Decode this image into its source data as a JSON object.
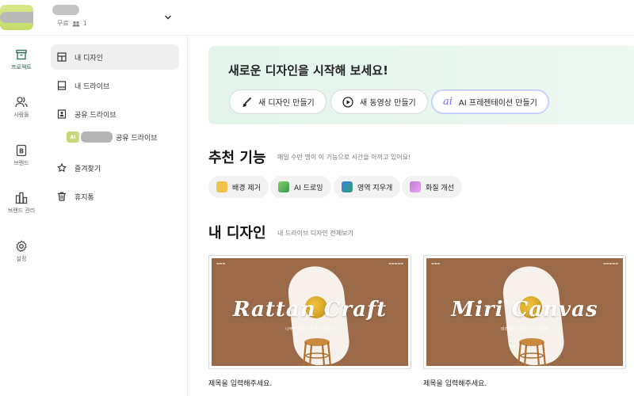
{
  "header": {
    "plan": "무료",
    "members": "1"
  },
  "rail": {
    "items": [
      {
        "label": "프로젝트",
        "icon": "project-icon"
      },
      {
        "label": "사람들",
        "icon": "people-icon"
      },
      {
        "label": "브랜드",
        "icon": "brand-icon"
      },
      {
        "label": "브랜드 관리",
        "icon": "brand-manage-icon"
      },
      {
        "label": "설정",
        "icon": "gear-icon"
      }
    ]
  },
  "sidebar": {
    "items": [
      {
        "label": "내 디자인",
        "icon": "grid-icon",
        "active": true
      },
      {
        "label": "내 드라이브",
        "icon": "drive-icon"
      },
      {
        "label": "공유 드라이브",
        "icon": "shared-drive-icon"
      },
      {
        "label": "즐겨찾기",
        "icon": "star-icon"
      },
      {
        "label": "휴지통",
        "icon": "trash-icon"
      }
    ],
    "shared_sub": {
      "badge": "AI",
      "label": "공유 드라이브"
    }
  },
  "hero": {
    "title": "새로운 디자인을 시작해 보세요!",
    "buttons": [
      {
        "label": "새 디자인 만들기",
        "icon": "brush-icon"
      },
      {
        "label": "새 동영상 만들기",
        "icon": "play-circle-icon"
      },
      {
        "label": "AI 프레젠테이션 만들기",
        "icon": "ai-icon",
        "mark": "ai"
      }
    ]
  },
  "features": {
    "title": "추천 기능",
    "subtitle": "매일 수만 명이 이 기능으로 시간을 아끼고 있어요!",
    "chips": [
      {
        "label": "배경 제거",
        "color": "#f3c24a"
      },
      {
        "label": "AI 드로잉",
        "color": "#7fcf6a"
      },
      {
        "label": "영역 지우개",
        "color": "#3f7fe0"
      },
      {
        "label": "화질 개선",
        "color": "#c27ad8"
      }
    ]
  },
  "designs": {
    "title": "내 디자인",
    "subtitle": "내 드라이브 디자인 전체보기",
    "cards": [
      {
        "thumb_title": "Rattan Craft",
        "thumb_sub": "나무와 라탄 소재 의자 만들기",
        "title": "제목을 입력해주세요."
      },
      {
        "thumb_title": "Miri Canvas",
        "thumb_sub": "미리캔버스 새로운 소식 정보",
        "title": "제목을 입력해주세요."
      }
    ]
  },
  "colors": {
    "accent_green": "#2a6a5a",
    "hero_bg": "#e6f6ec",
    "thumb_bg": "#9a6a48"
  }
}
